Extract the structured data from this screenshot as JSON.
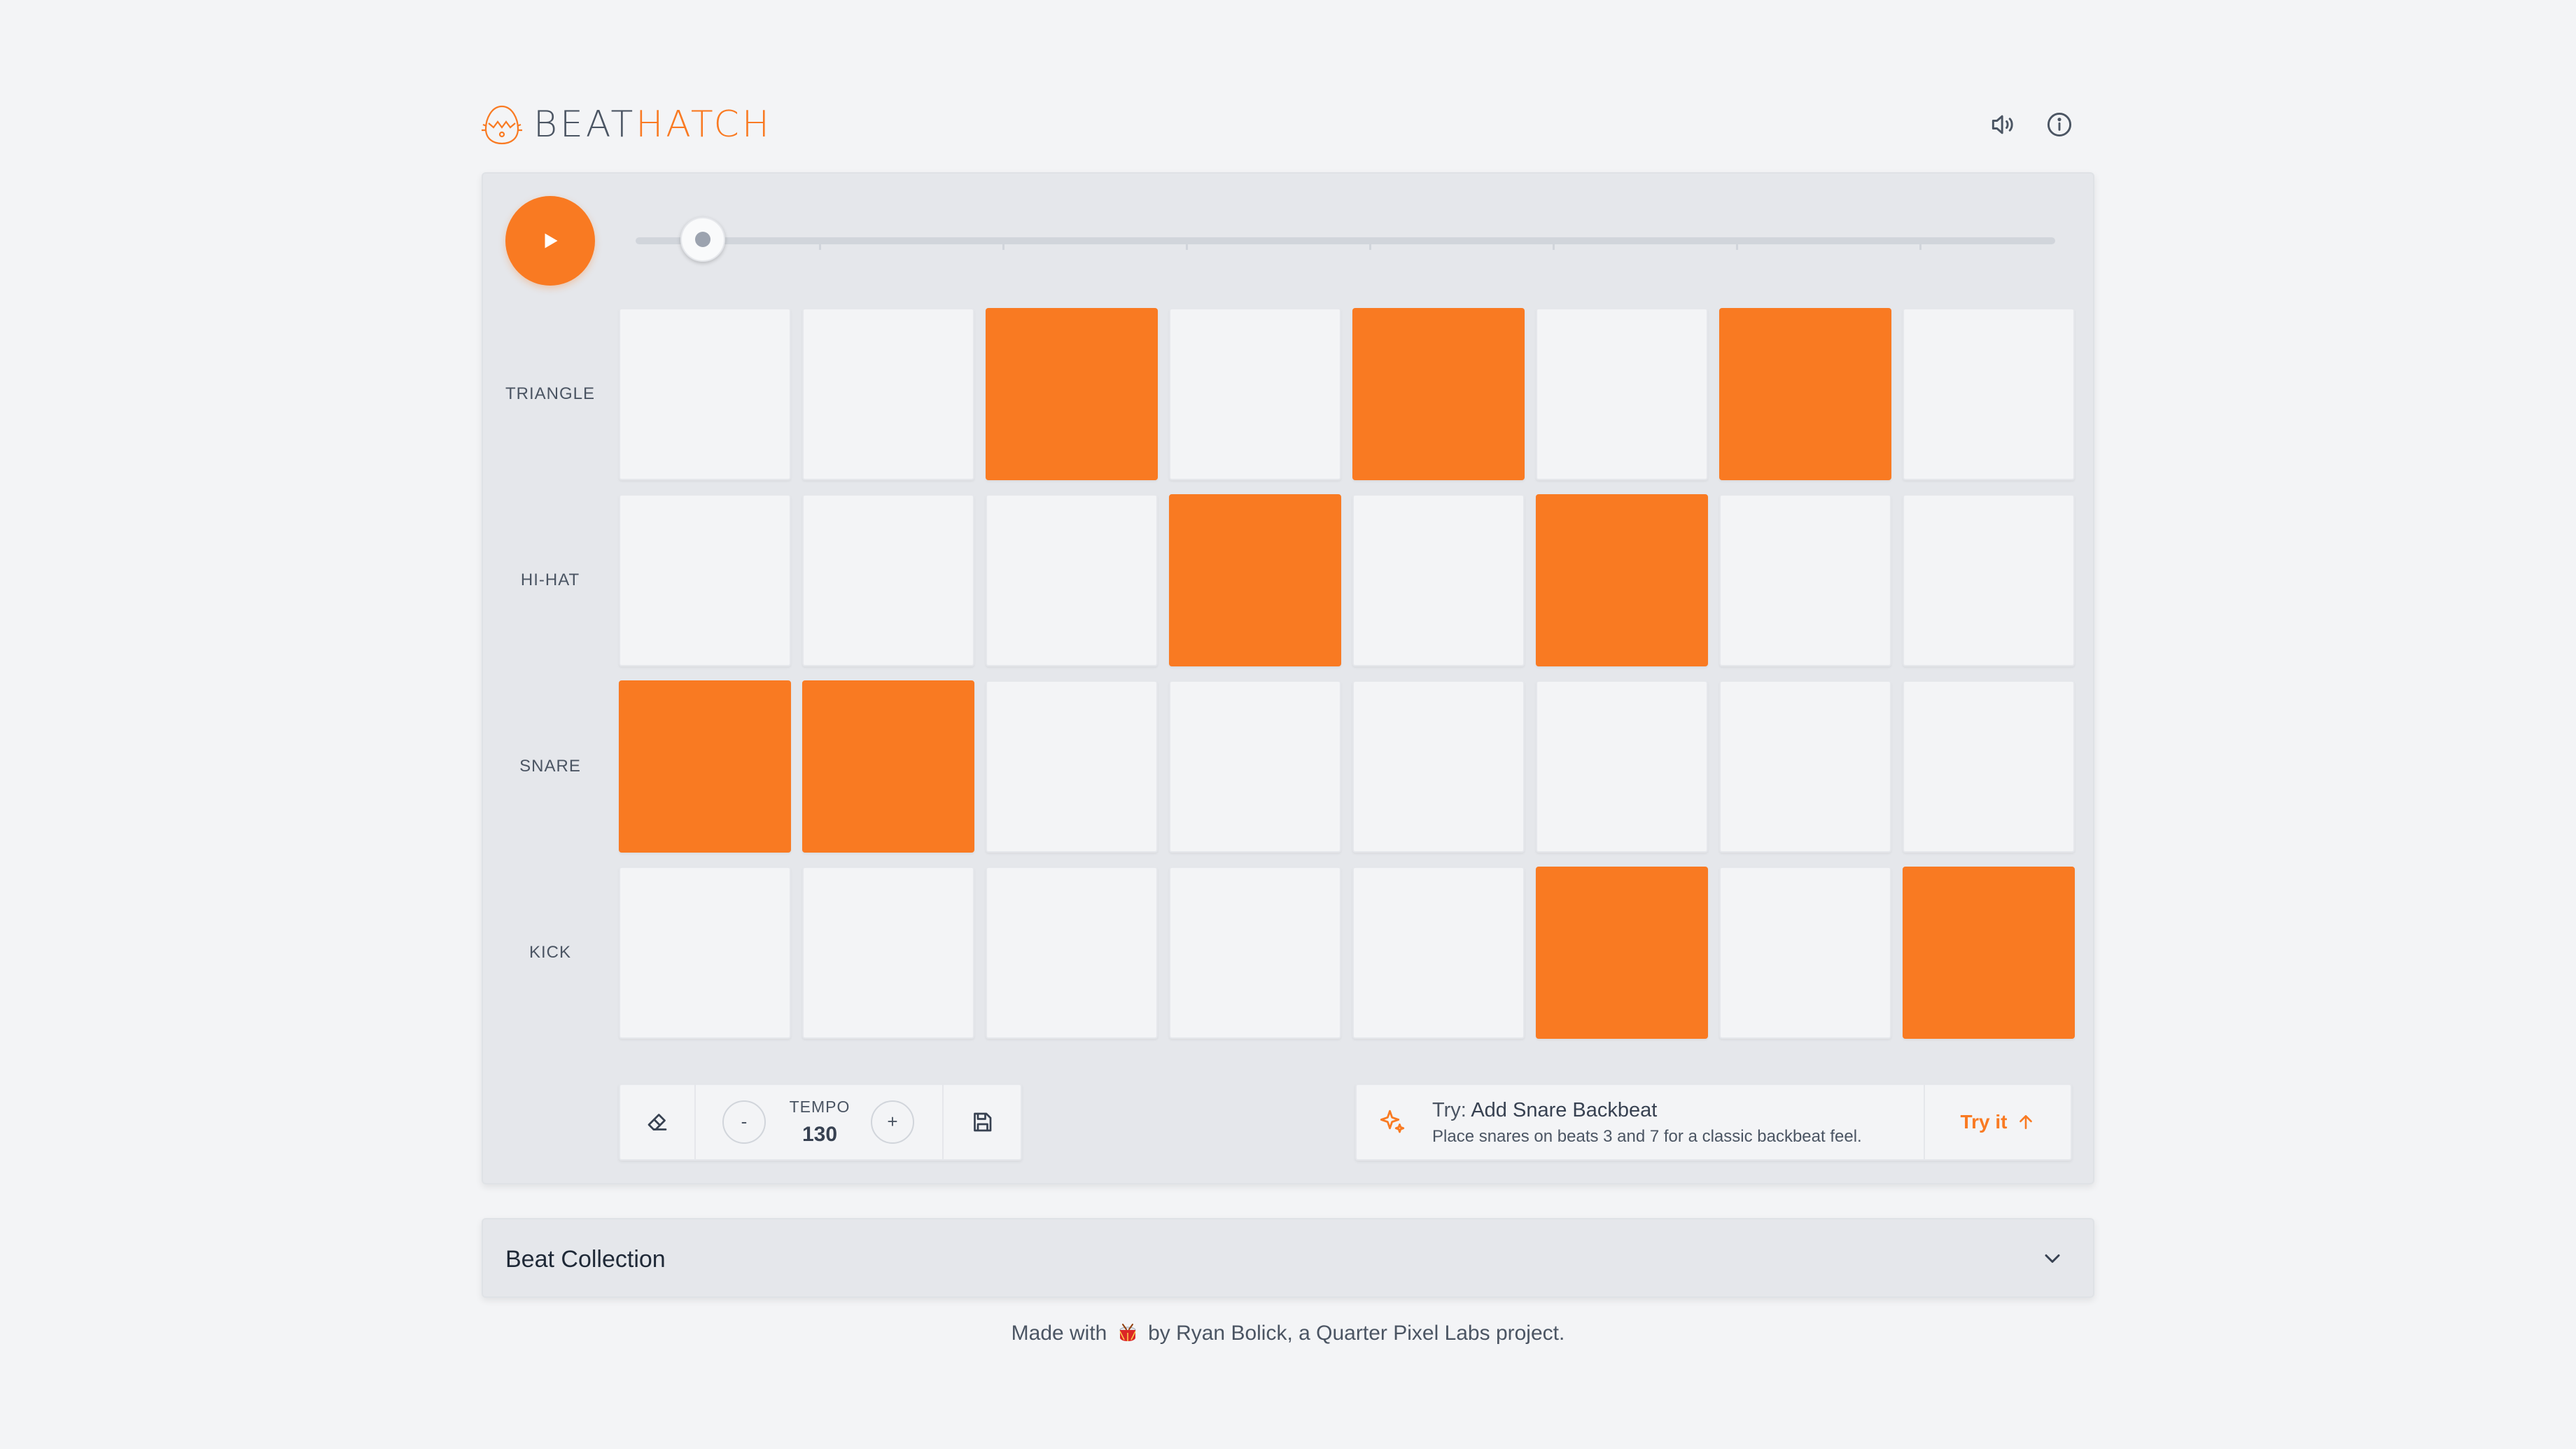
{
  "header": {
    "brand_part1": "BEAT",
    "brand_part2": "HATCH",
    "icons": [
      "egg-logo-icon",
      "speaker-icon",
      "info-icon"
    ]
  },
  "player": {
    "play_icon": "play-icon",
    "playhead_step": 1,
    "total_steps": 8
  },
  "tracks": [
    {
      "label": "TRIANGLE",
      "steps": [
        0,
        0,
        1,
        0,
        1,
        0,
        1,
        0
      ]
    },
    {
      "label": "HI-HAT",
      "steps": [
        0,
        0,
        0,
        1,
        0,
        1,
        0,
        0
      ]
    },
    {
      "label": "SNARE",
      "steps": [
        1,
        1,
        0,
        0,
        0,
        0,
        0,
        0
      ]
    },
    {
      "label": "KICK",
      "steps": [
        0,
        0,
        0,
        0,
        0,
        1,
        0,
        1
      ]
    }
  ],
  "toolbar": {
    "erase_icon": "eraser-icon",
    "tempo_label": "TEMPO",
    "tempo_value": "130",
    "minus_label": "-",
    "plus_label": "+",
    "save_icon": "save-icon"
  },
  "suggestion": {
    "prefix": "Try:",
    "title": "Add Snare Backbeat",
    "description": "Place snares on beats 3 and 7 for a classic backbeat feel.",
    "action_label": "Try it",
    "icon": "sparkle-icon"
  },
  "collection": {
    "title": "Beat Collection",
    "icon": "chevron-down-icon"
  },
  "footer": {
    "text_before": "Made with",
    "text_after": "by Ryan Bolick, a Quarter Pixel Labs project."
  },
  "colors": {
    "accent": "#f97a22",
    "cell_off": "#f3f4f6",
    "panel": "#e5e7eb",
    "background": "#f3f4f6"
  }
}
